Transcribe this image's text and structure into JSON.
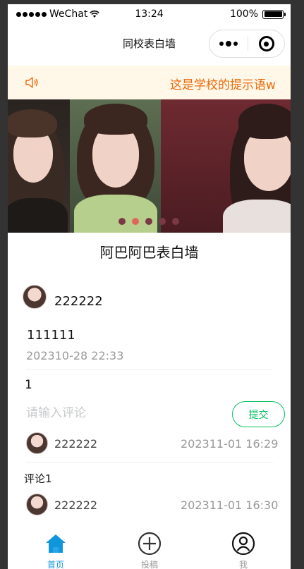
{
  "status_bar": {
    "carrier": "WeChat",
    "time": "13:24",
    "battery": "100%",
    "battery_level": 1.0
  },
  "nav": {
    "title": "同校表白墙"
  },
  "notice": {
    "text": "这是学校的提示语w",
    "color": "#ed6a0c",
    "icon": "speaker-icon"
  },
  "carousel": {
    "slide_count": 5,
    "active_index": 1
  },
  "wall": {
    "title": "阿巴阿巴表白墙"
  },
  "post": {
    "username": "222222",
    "content": "111111",
    "time": "202310-28 22:33",
    "comment_count": "1"
  },
  "comment_box": {
    "placeholder": "请输入评论",
    "submit_label": "提交",
    "accent": "#07c160"
  },
  "comments": [
    {
      "username": "222222",
      "time": "202311-01 16:29",
      "text": "评论1"
    },
    {
      "username": "222222",
      "time": "202311-01 16:30"
    }
  ],
  "tabs": [
    {
      "label": "首页",
      "icon": "home-icon",
      "active": true
    },
    {
      "label": "投稿",
      "icon": "plus-circle-icon",
      "active": false
    },
    {
      "label": "我",
      "icon": "user-icon",
      "active": false
    }
  ],
  "colors": {
    "tab_active": "#1296db",
    "tab_inactive": "#999999"
  }
}
